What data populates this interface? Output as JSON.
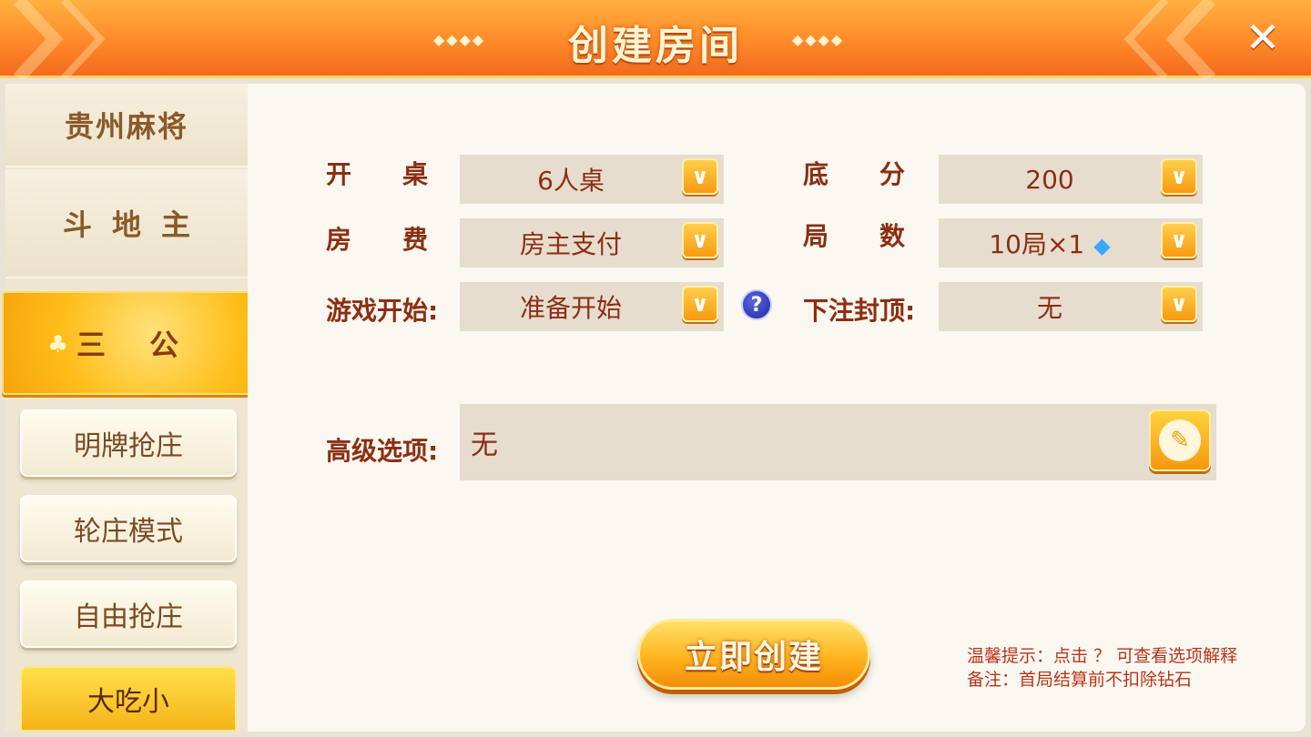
{
  "header": {
    "title": "创建房间",
    "deco_left": "◆◆◆◆",
    "deco_right": "◆◆◆◆",
    "close_symbol": "✕"
  },
  "sidebar": {
    "categories": [
      {
        "label": "贵州麻将"
      },
      {
        "label": "斗地主"
      },
      {
        "label": "三公",
        "selected": true
      }
    ],
    "modes": [
      {
        "label": "明牌抢庄"
      },
      {
        "label": "轮庄模式"
      },
      {
        "label": "自由抢庄"
      },
      {
        "label": "大吃小",
        "selected": true
      }
    ]
  },
  "form": {
    "table": {
      "label": "开桌:",
      "value": "6人桌"
    },
    "fee": {
      "label": "房费:",
      "value": "房主支付"
    },
    "start": {
      "label": "游戏开始:",
      "value": "准备开始"
    },
    "base_score": {
      "label": "底分:",
      "value": "200"
    },
    "rounds": {
      "label": "局数:",
      "value": "10局×1"
    },
    "bet_cap": {
      "label": "下注封顶:",
      "value": "无"
    },
    "advanced": {
      "label": "高级选项:",
      "value": "无"
    },
    "help_symbol": "?",
    "dropdown_symbol": "∨"
  },
  "actions": {
    "create_label": "立即创建"
  },
  "tips": {
    "line1": "温馨提示：点击 ？ 可查看选项解释",
    "line2": "备注：首局结算前不扣除钻石"
  },
  "colors": {
    "accent": "#f79a12",
    "label_text": "#8c2e12",
    "header": "#ff8a2a"
  }
}
